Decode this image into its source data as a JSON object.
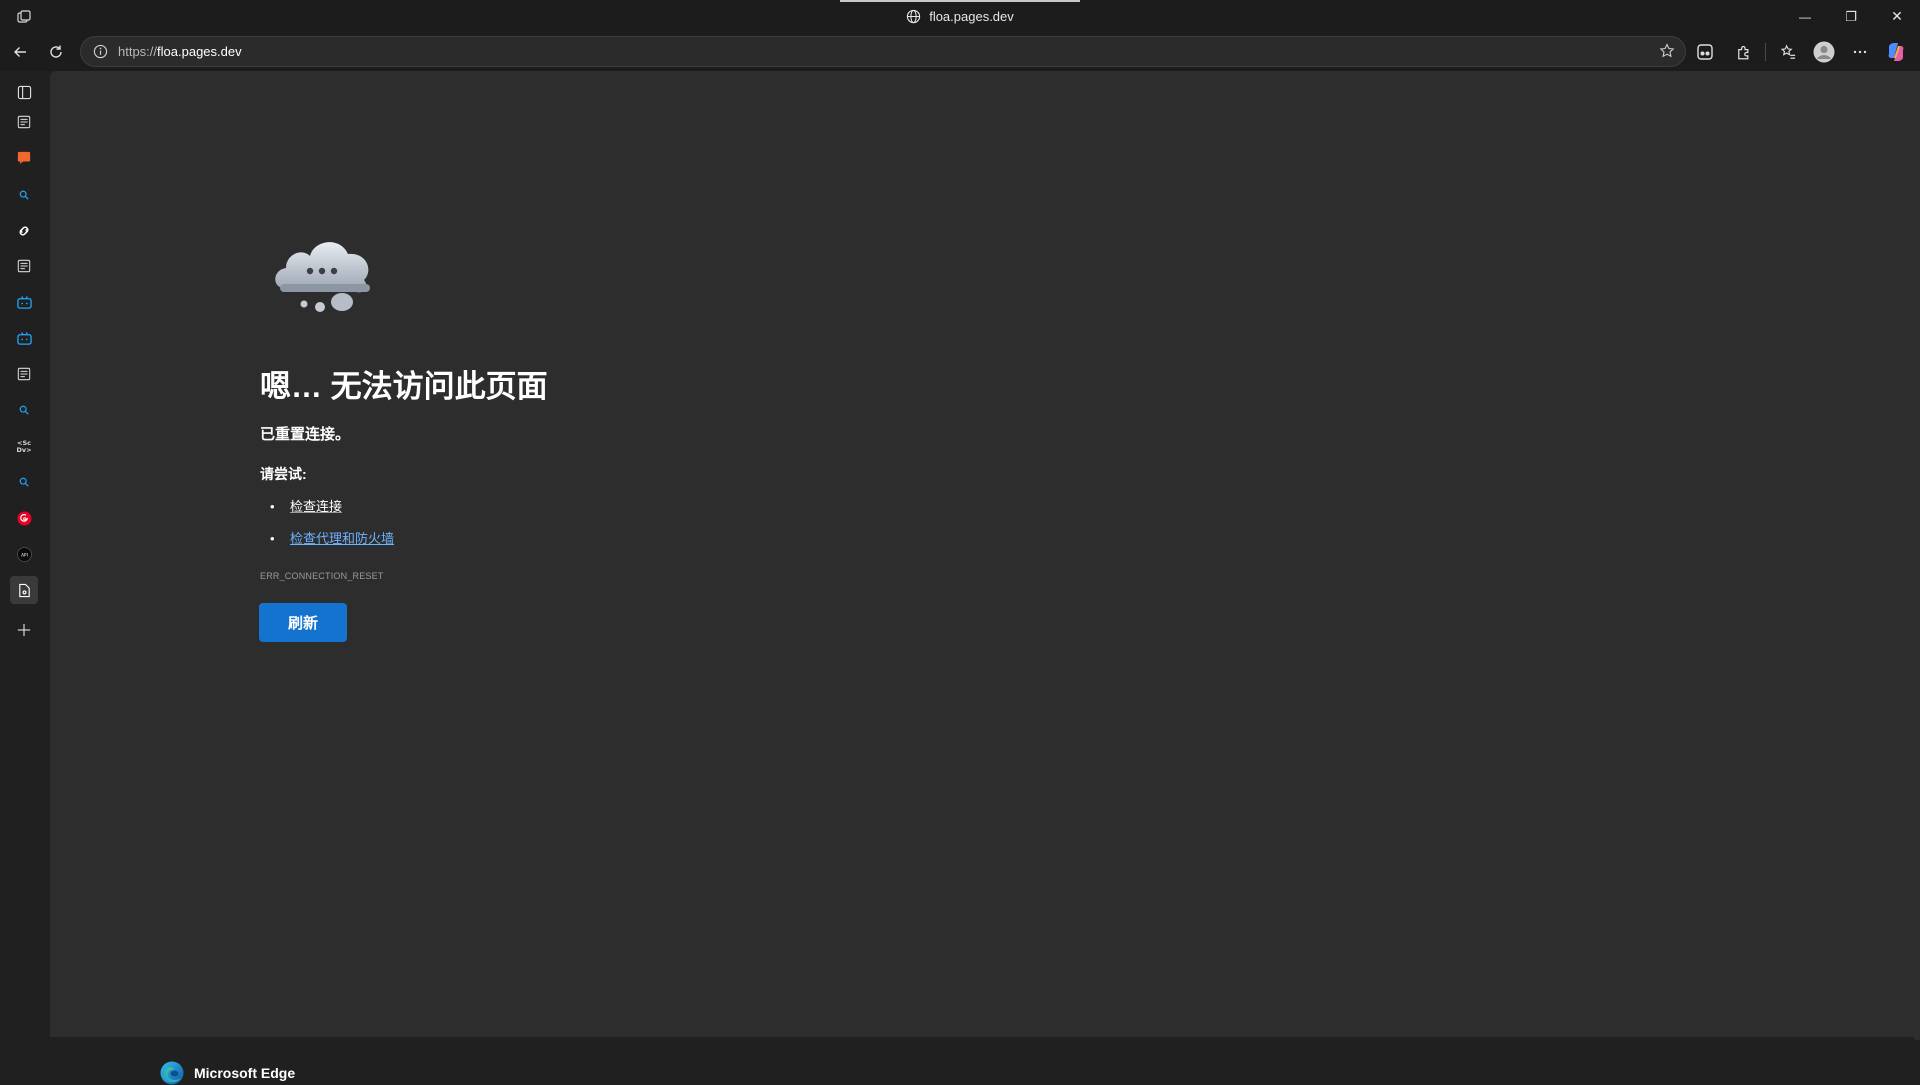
{
  "window": {
    "title": "floa.pages.dev",
    "controls": {
      "minimize": "—",
      "restore": "❐",
      "close": "✕"
    }
  },
  "toolbar": {
    "url_protocol": "https://",
    "url_host": "floa.pages.dev"
  },
  "sidebar": {
    "items": [
      {
        "icon": "vertical-tabs-icon"
      },
      {
        "icon": "tab-page-icon"
      },
      {
        "icon": "orange-chat-icon"
      },
      {
        "icon": "search-icon"
      },
      {
        "icon": "link-icon"
      },
      {
        "icon": "tab-page-icon"
      },
      {
        "icon": "bilibili-tv-icon"
      },
      {
        "icon": "bilibili-tv-icon"
      },
      {
        "icon": "tab-page-icon"
      },
      {
        "icon": "search-icon"
      },
      {
        "icon": "scdv-icon"
      },
      {
        "icon": "search-icon"
      },
      {
        "icon": "netease-music-icon"
      },
      {
        "icon": "black-circle-icon"
      },
      {
        "icon": "gear-document-icon"
      },
      {
        "icon": "plus-icon"
      }
    ]
  },
  "error": {
    "title": "嗯… 无法访问此页面",
    "subtitle": "已重置连接。",
    "try_label": "请尝试:",
    "tips": [
      {
        "text": "检查连接",
        "link": false
      },
      {
        "text": "检查代理和防火墙",
        "link": true
      }
    ],
    "code": "ERR_CONNECTION_RESET",
    "refresh_label": "刷新"
  },
  "brand": {
    "name": "Microsoft Edge"
  },
  "colors": {
    "accent": "#1473cf",
    "link": "#6cb2ff",
    "content_bg": "#2d2d2d",
    "chrome_bg": "#1c1c1c"
  }
}
